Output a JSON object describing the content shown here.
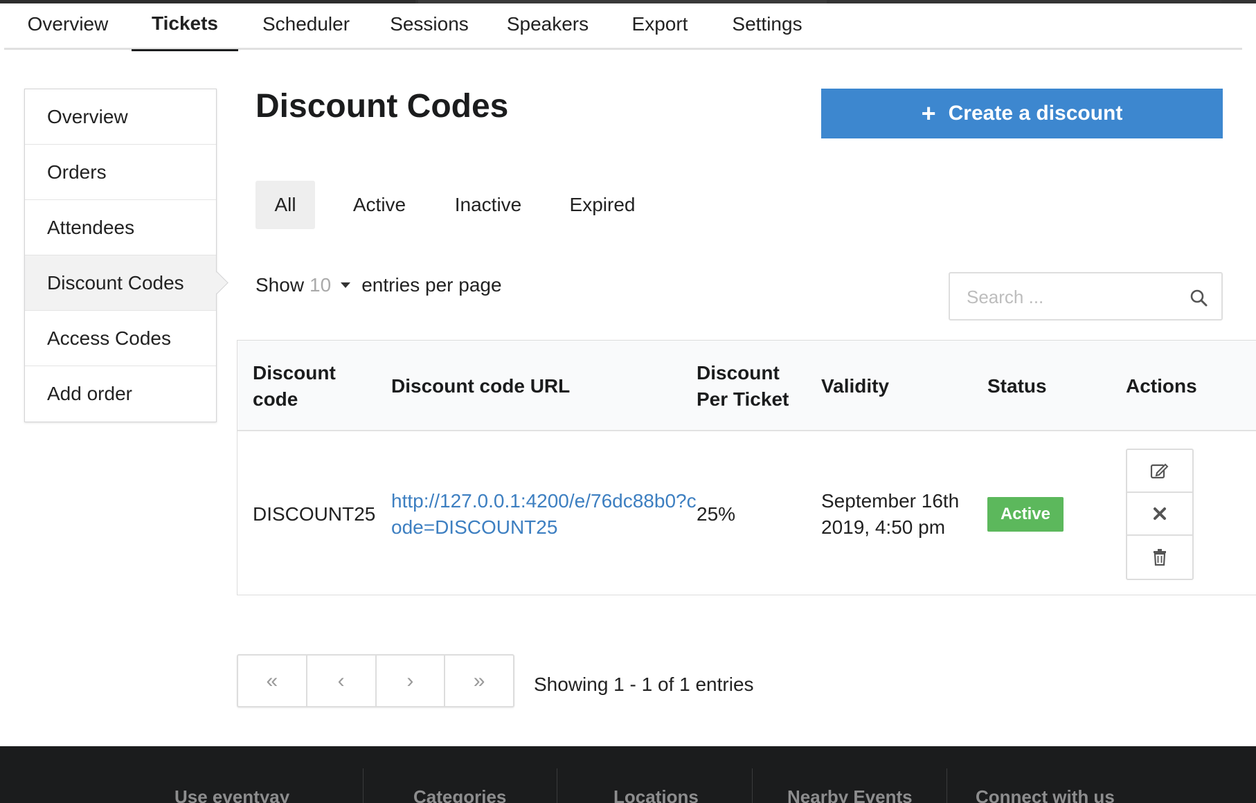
{
  "top_tabs": [
    {
      "label": "Overview"
    },
    {
      "label": "Tickets"
    },
    {
      "label": "Scheduler"
    },
    {
      "label": "Sessions"
    },
    {
      "label": "Speakers"
    },
    {
      "label": "Export"
    },
    {
      "label": "Settings"
    }
  ],
  "active_top_tab": "Tickets",
  "sidebar": {
    "items": [
      {
        "label": "Overview"
      },
      {
        "label": "Orders"
      },
      {
        "label": "Attendees"
      },
      {
        "label": "Discount Codes"
      },
      {
        "label": "Access Codes"
      },
      {
        "label": "Add order"
      }
    ],
    "active": "Discount Codes"
  },
  "page": {
    "title": "Discount Codes",
    "create_button": {
      "label": "Create a discount",
      "icon": "plus-icon",
      "color": "#3d87cf"
    }
  },
  "filters": {
    "items": [
      {
        "label": "All"
      },
      {
        "label": "Active"
      },
      {
        "label": "Inactive"
      },
      {
        "label": "Expired"
      }
    ],
    "active": "All"
  },
  "entries": {
    "show_label": "Show",
    "per_page_value": "10",
    "suffix_label": "entries per page"
  },
  "search": {
    "placeholder": "Search ...",
    "value": "",
    "icon": "search-icon"
  },
  "table": {
    "headers": {
      "code": "Discount code",
      "url": "Discount code URL",
      "per_ticket": "Discount Per Ticket",
      "validity": "Validity",
      "status": "Status",
      "actions": "Actions"
    },
    "rows": [
      {
        "code": "DISCOUNT25",
        "url": "http://127.0.0.1:4200/e/76dc88b0?code=DISCOUNT25",
        "per_ticket": "25%",
        "validity": "September 16th 2019, 4:50 pm",
        "status": "Active",
        "status_color": "#5cb85c",
        "actions": [
          "edit-icon",
          "close-icon",
          "trash-icon"
        ]
      }
    ]
  },
  "pagination": {
    "first": "«",
    "prev": "‹",
    "next": "›",
    "last": "»",
    "summary": "Showing 1 - 1 of 1 entries"
  },
  "footer": {
    "columns": [
      "Use eventyay",
      "Categories",
      "Locations",
      "Nearby Events",
      "Connect with us"
    ]
  },
  "colors": {
    "accent": "#3d87cf",
    "link": "#3d7fc1",
    "success": "#5cb85c",
    "footer_bg": "#1b1c1d"
  }
}
